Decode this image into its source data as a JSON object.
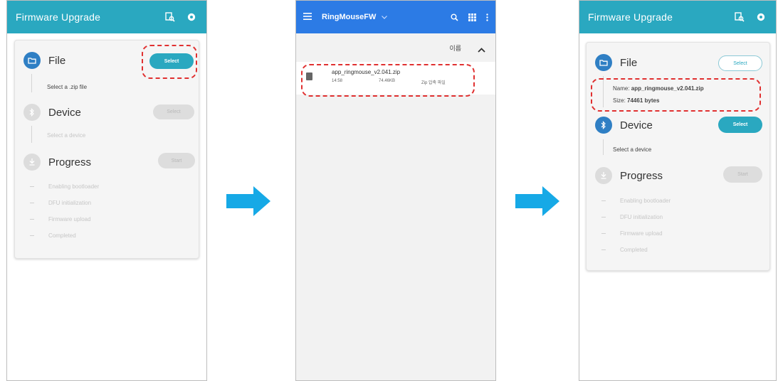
{
  "colors": {
    "teal_appbar": "#2aa8c0",
    "picker_blue": "#2c7be5",
    "step_active_blue": "#2f7fc4",
    "highlight_red": "#e03030",
    "arrow_blue": "#16a9e6"
  },
  "screen1": {
    "title": "Firmware Upgrade",
    "icons": [
      "search-doc-icon",
      "gear-icon"
    ],
    "steps": {
      "file": {
        "label": "File",
        "button": "Select",
        "hint": "Select a .zip file",
        "icon": "folder-icon"
      },
      "device": {
        "label": "Device",
        "button": "Select",
        "hint": "Select a device",
        "icon": "bluetooth-icon"
      },
      "progress": {
        "label": "Progress",
        "button": "Start",
        "icon": "download-icon"
      }
    },
    "progress_items": [
      "Enabling bootloader",
      "DFU initialization",
      "Firmware upload",
      "Completed"
    ]
  },
  "screen2": {
    "folder": "RingMouseFW",
    "sort_label": "이름",
    "icons": [
      "menu-icon",
      "chevron-down-icon",
      "search-icon",
      "grid-view-icon",
      "more-icon",
      "sort-up-icon"
    ],
    "file": {
      "name": "app_ringmouse_v2.041.zip",
      "time": "14:58",
      "size": "74.46KB",
      "type": "Zip 압축 파일"
    }
  },
  "screen3": {
    "title": "Firmware Upgrade",
    "steps": {
      "file": {
        "label": "File",
        "button": "Select"
      },
      "device": {
        "label": "Device",
        "button": "Select",
        "hint": "Select a device"
      },
      "progress": {
        "label": "Progress",
        "button": "Start"
      }
    },
    "file_info": {
      "name_label": "Name:",
      "name_value": "app_ringmouse_v2.041.zip",
      "size_label": "Size:",
      "size_value": "74461 bytes"
    },
    "progress_items": [
      "Enabling bootloader",
      "DFU initialization",
      "Firmware upload",
      "Completed"
    ]
  }
}
